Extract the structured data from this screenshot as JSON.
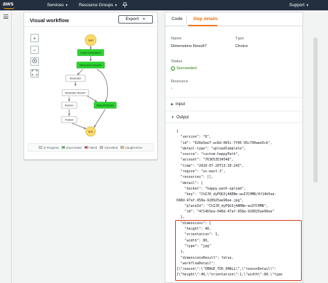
{
  "topnav": {
    "logo_text": "aws",
    "services_label": "Services",
    "resource_groups_label": "Resource Groups",
    "support_label": "Support"
  },
  "workflow": {
    "title": "Visual workflow",
    "export_label": "Export",
    "nodes": [
      {
        "id": "start",
        "label": "Start",
        "state": "start"
      },
      {
        "id": "check",
        "label": "Check Dimensions",
        "state": "succeeded"
      },
      {
        "id": "dimres",
        "label": "Dimensions Result?",
        "state": "succeeded"
      },
      {
        "id": "moderator",
        "label": "Moderator",
        "state": "notrun"
      },
      {
        "id": "modres",
        "label": "Moderator Result?",
        "state": "notrun"
      },
      {
        "id": "resize",
        "label": "Resizer",
        "state": "notrun"
      },
      {
        "id": "publish",
        "label": "Publish",
        "state": "notrun"
      },
      {
        "id": "reject",
        "label": "RejectPublicate",
        "state": "succeeded"
      },
      {
        "id": "end",
        "label": "End",
        "state": "start"
      }
    ],
    "legend": [
      {
        "label": "In Progress",
        "color": "#cce4f7"
      },
      {
        "label": "Succeeded",
        "color": "#2bd62e"
      },
      {
        "label": "Failed",
        "color": "#de322f"
      },
      {
        "label": "Cancelled",
        "color": "#c8c8c8"
      },
      {
        "label": "Caught Error",
        "color": "#ffb366"
      }
    ]
  },
  "details": {
    "tab_code": "Code",
    "tab_step": "Step details",
    "name_label": "Name",
    "name_value": "Dimensions Result?",
    "type_label": "Type",
    "type_value": "Choice",
    "status_label": "Status",
    "status_value": "Succeeded",
    "resource_label": "Resource",
    "resource_value": "-",
    "input_label": "Input",
    "output_label": "Output",
    "code_lines": [
      "{",
      "  \"version\": \"0\",",
      "  \"id\": \"026e5ee7-ac8d-065c-7f66-95c790aee5cb\",",
      "  \"detail-type\": \"uploadComplete\",",
      "  \"source\": \"custom.happyPath\",",
      "  \"account\": \"763653534548\",",
      "  \"time\": \"2020-07-20T13:10:24Z\",",
      "  \"region\": \"us-east-1\",",
      "  \"resources\": [],",
      "  \"detail\": {",
      "    \"bucket\": \"happy-path-upload\",",
      "    \"key\": \"ChIJ0_dyPQG3j4ARNe-wuIYCHM8/4f14b5ea-",
      "048d-47af-958a-928925ae96ee.jpg\",",
      "    \"placeId\": \"ChIJ0_dyPQG3j4ARNe-wuIYCHM8\",",
      "    \"id\": \"4f14b5ea-048d-47af-958a-928925ae96ee\"",
      "  },",
      "  \"dimensions\": {",
      "    \"height\": 40,",
      "    \"orientation\": 1,",
      "    \"width\": 80,",
      "    \"type\": \"jpg\"",
      "  },",
      "  \"dimensionsResult\": false,",
      "  \"workflowDetail\":",
      "{\\\"reason\\\":\\\"IMAGE_TOO_SMALL\\\",\\\"reasonDetail\\\":",
      "{\\\"height\\\":40,\\\"orientation\\\":1,\\\"width\\\":80,\\\"type"
    ]
  }
}
